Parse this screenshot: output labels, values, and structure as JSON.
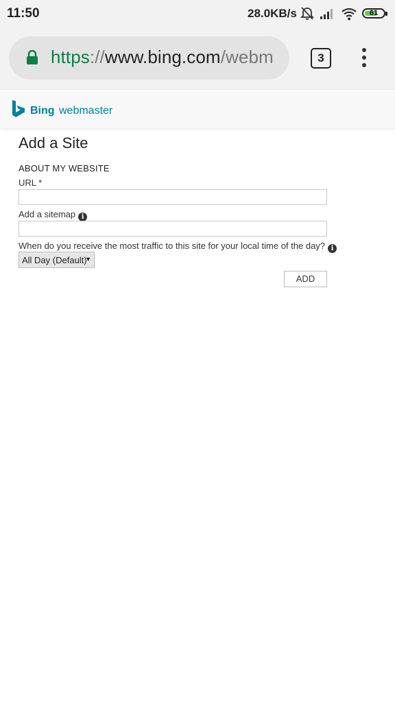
{
  "status_bar": {
    "time": "11:50",
    "net_speed": "28.0KB/s",
    "battery": "61",
    "icons": [
      "bell-off-icon",
      "signal-icon",
      "wifi-icon",
      "battery-icon"
    ]
  },
  "browser": {
    "url_scheme": "https",
    "url_sep": "://",
    "url_host": "www.bing.com",
    "url_path": "/webm",
    "tab_count": "3",
    "accent_color": "#0b8043"
  },
  "header": {
    "brand": "Bing",
    "product": "webmaster",
    "brand_color": "#00809d"
  },
  "form": {
    "title": "Add a Site",
    "section_heading": "ABOUT MY WEBSITE",
    "url_label": "URL *",
    "url_value": "",
    "sitemap_label": "Add a sitemap",
    "sitemap_value": "",
    "traffic_label": "When do you receive the most traffic to this site for your local time of the day?",
    "traffic_selected": "All Day (Default)",
    "add_button": "ADD"
  }
}
